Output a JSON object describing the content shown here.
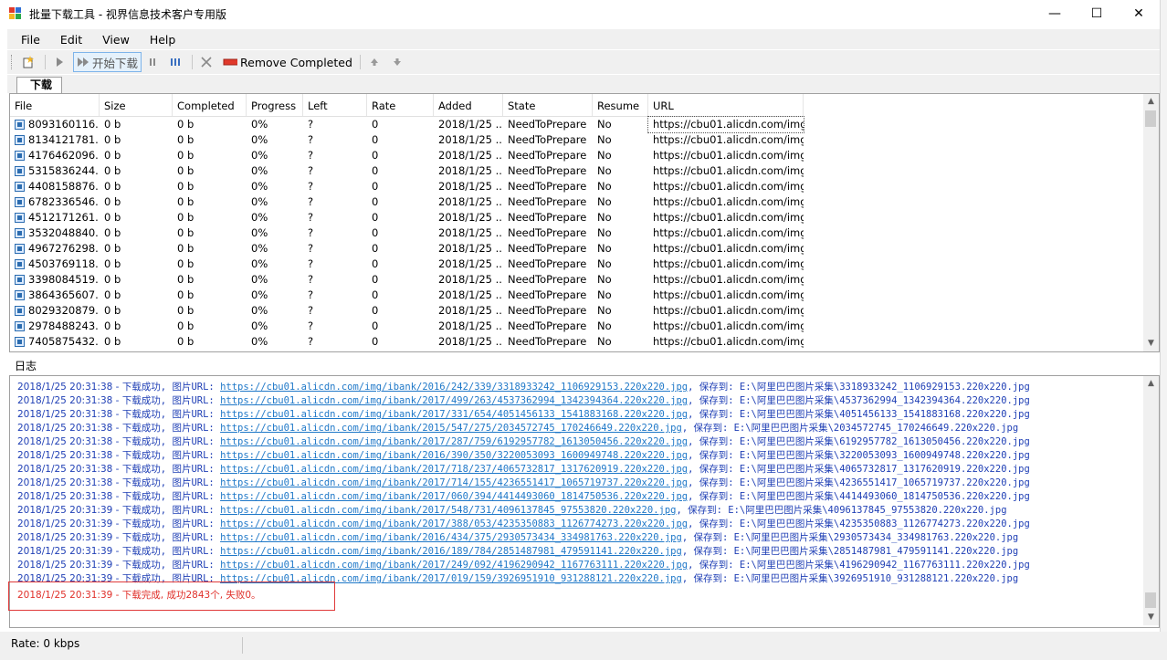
{
  "window": {
    "title": "批量下载工具 - 视界信息技术客户专用版",
    "minimize": "—",
    "maximize": "☐",
    "close": "✕"
  },
  "menu": [
    "File",
    "Edit",
    "View",
    "Help"
  ],
  "toolbar": {
    "start_label": "开始下载",
    "remove_label": "Remove Completed"
  },
  "tab": "下载",
  "table": {
    "columns": [
      "File",
      "Size",
      "Completed",
      "Progress",
      "Left",
      "Rate",
      "Added",
      "State",
      "Resume",
      "URL"
    ],
    "rows": [
      [
        "8093160116...",
        "0 b",
        "0 b",
        "0%",
        "?",
        "0",
        "2018/1/25 ...",
        "NeedToPrepare",
        "No",
        "https://cbu01.alicdn.com/img/i..."
      ],
      [
        "8134121781...",
        "0 b",
        "0 b",
        "0%",
        "?",
        "0",
        "2018/1/25 ...",
        "NeedToPrepare",
        "No",
        "https://cbu01.alicdn.com/img/i..."
      ],
      [
        "4176462096...",
        "0 b",
        "0 b",
        "0%",
        "?",
        "0",
        "2018/1/25 ...",
        "NeedToPrepare",
        "No",
        "https://cbu01.alicdn.com/img/i..."
      ],
      [
        "5315836244...",
        "0 b",
        "0 b",
        "0%",
        "?",
        "0",
        "2018/1/25 ...",
        "NeedToPrepare",
        "No",
        "https://cbu01.alicdn.com/img/i..."
      ],
      [
        "4408158876...",
        "0 b",
        "0 b",
        "0%",
        "?",
        "0",
        "2018/1/25 ...",
        "NeedToPrepare",
        "No",
        "https://cbu01.alicdn.com/img/i..."
      ],
      [
        "6782336546...",
        "0 b",
        "0 b",
        "0%",
        "?",
        "0",
        "2018/1/25 ...",
        "NeedToPrepare",
        "No",
        "https://cbu01.alicdn.com/img/i..."
      ],
      [
        "4512171261...",
        "0 b",
        "0 b",
        "0%",
        "?",
        "0",
        "2018/1/25 ...",
        "NeedToPrepare",
        "No",
        "https://cbu01.alicdn.com/img/i..."
      ],
      [
        "3532048840...",
        "0 b",
        "0 b",
        "0%",
        "?",
        "0",
        "2018/1/25 ...",
        "NeedToPrepare",
        "No",
        "https://cbu01.alicdn.com/img/i..."
      ],
      [
        "4967276298...",
        "0 b",
        "0 b",
        "0%",
        "?",
        "0",
        "2018/1/25 ...",
        "NeedToPrepare",
        "No",
        "https://cbu01.alicdn.com/img/i..."
      ],
      [
        "4503769118...",
        "0 b",
        "0 b",
        "0%",
        "?",
        "0",
        "2018/1/25 ...",
        "NeedToPrepare",
        "No",
        "https://cbu01.alicdn.com/img/i..."
      ],
      [
        "3398084519...",
        "0 b",
        "0 b",
        "0%",
        "?",
        "0",
        "2018/1/25 ...",
        "NeedToPrepare",
        "No",
        "https://cbu01.alicdn.com/img/i..."
      ],
      [
        "3864365607...",
        "0 b",
        "0 b",
        "0%",
        "?",
        "0",
        "2018/1/25 ...",
        "NeedToPrepare",
        "No",
        "https://cbu01.alicdn.com/img/i..."
      ],
      [
        "8029320879...",
        "0 b",
        "0 b",
        "0%",
        "?",
        "0",
        "2018/1/25 ...",
        "NeedToPrepare",
        "No",
        "https://cbu01.alicdn.com/img/i..."
      ],
      [
        "2978488243...",
        "0 b",
        "0 b",
        "0%",
        "?",
        "0",
        "2018/1/25 ...",
        "NeedToPrepare",
        "No",
        "https://cbu01.alicdn.com/img/i..."
      ],
      [
        "7405875432...",
        "0 b",
        "0 b",
        "0%",
        "?",
        "0",
        "2018/1/25 ...",
        "NeedToPrepare",
        "No",
        "https://cbu01.alicdn.com/img/i..."
      ]
    ]
  },
  "log": {
    "label": "日志",
    "lines": [
      {
        "ts": "2018/1/25 20:31:38 - ",
        "pre": "下载成功, 图片URL: ",
        "url": "https://cbu01.alicdn.com/img/ibank/2016/242/339/3318933242_1106929153.220x220.jpg",
        "post": ", 保存到: E:\\阿里巴巴图片采集\\3318933242_1106929153.220x220.jpg"
      },
      {
        "ts": "2018/1/25 20:31:38 - ",
        "pre": "下载成功, 图片URL: ",
        "url": "https://cbu01.alicdn.com/img/ibank/2017/499/263/4537362994_1342394364.220x220.jpg",
        "post": ", 保存到: E:\\阿里巴巴图片采集\\4537362994_1342394364.220x220.jpg"
      },
      {
        "ts": "2018/1/25 20:31:38 - ",
        "pre": "下载成功, 图片URL: ",
        "url": "https://cbu01.alicdn.com/img/ibank/2017/331/654/4051456133_1541883168.220x220.jpg",
        "post": ", 保存到: E:\\阿里巴巴图片采集\\4051456133_1541883168.220x220.jpg"
      },
      {
        "ts": "2018/1/25 20:31:38 - ",
        "pre": "下载成功, 图片URL: ",
        "url": "https://cbu01.alicdn.com/img/ibank/2015/547/275/2034572745_170246649.220x220.jpg",
        "post": ", 保存到: E:\\阿里巴巴图片采集\\2034572745_170246649.220x220.jpg"
      },
      {
        "ts": "2018/1/25 20:31:38 - ",
        "pre": "下载成功, 图片URL: ",
        "url": "https://cbu01.alicdn.com/img/ibank/2017/287/759/6192957782_1613050456.220x220.jpg",
        "post": ", 保存到: E:\\阿里巴巴图片采集\\6192957782_1613050456.220x220.jpg"
      },
      {
        "ts": "2018/1/25 20:31:38 - ",
        "pre": "下载成功, 图片URL: ",
        "url": "https://cbu01.alicdn.com/img/ibank/2016/390/350/3220053093_1600949748.220x220.jpg",
        "post": ", 保存到: E:\\阿里巴巴图片采集\\3220053093_1600949748.220x220.jpg"
      },
      {
        "ts": "2018/1/25 20:31:38 - ",
        "pre": "下载成功, 图片URL: ",
        "url": "https://cbu01.alicdn.com/img/ibank/2017/718/237/4065732817_1317620919.220x220.jpg",
        "post": ", 保存到: E:\\阿里巴巴图片采集\\4065732817_1317620919.220x220.jpg"
      },
      {
        "ts": "2018/1/25 20:31:38 - ",
        "pre": "下载成功, 图片URL: ",
        "url": "https://cbu01.alicdn.com/img/ibank/2017/714/155/4236551417_1065719737.220x220.jpg",
        "post": ", 保存到: E:\\阿里巴巴图片采集\\4236551417_1065719737.220x220.jpg"
      },
      {
        "ts": "2018/1/25 20:31:38 - ",
        "pre": "下载成功, 图片URL: ",
        "url": "https://cbu01.alicdn.com/img/ibank/2017/060/394/4414493060_1814750536.220x220.jpg",
        "post": ", 保存到: E:\\阿里巴巴图片采集\\4414493060_1814750536.220x220.jpg"
      },
      {
        "ts": "2018/1/25 20:31:39 - ",
        "pre": "下载成功, 图片URL: ",
        "url": "https://cbu01.alicdn.com/img/ibank/2017/548/731/4096137845_97553820.220x220.jpg",
        "post": ", 保存到: E:\\阿里巴巴图片采集\\4096137845_97553820.220x220.jpg"
      },
      {
        "ts": "2018/1/25 20:31:39 - ",
        "pre": "下载成功, 图片URL: ",
        "url": "https://cbu01.alicdn.com/img/ibank/2017/388/053/4235350883_1126774273.220x220.jpg",
        "post": ", 保存到: E:\\阿里巴巴图片采集\\4235350883_1126774273.220x220.jpg"
      },
      {
        "ts": "2018/1/25 20:31:39 - ",
        "pre": "下载成功, 图片URL: ",
        "url": "https://cbu01.alicdn.com/img/ibank/2016/434/375/2930573434_334981763.220x220.jpg",
        "post": ", 保存到: E:\\阿里巴巴图片采集\\2930573434_334981763.220x220.jpg"
      },
      {
        "ts": "2018/1/25 20:31:39 - ",
        "pre": "下载成功, 图片URL: ",
        "url": "https://cbu01.alicdn.com/img/ibank/2016/189/784/2851487981_479591141.220x220.jpg",
        "post": ", 保存到: E:\\阿里巴巴图片采集\\2851487981_479591141.220x220.jpg"
      },
      {
        "ts": "2018/1/25 20:31:39 - ",
        "pre": "下载成功, 图片URL: ",
        "url": "https://cbu01.alicdn.com/img/ibank/2017/249/092/4196290942_1167763111.220x220.jpg",
        "post": ", 保存到: E:\\阿里巴巴图片采集\\4196290942_1167763111.220x220.jpg"
      },
      {
        "ts": "2018/1/25 20:31:39 - ",
        "pre": "下载成功, 图片URL: ",
        "url": "https://cbu01.alicdn.com/img/ibank/2017/019/159/3926951910_931288121.220x220.jpg",
        "post": ", 保存到: E:\\阿里巴巴图片采集\\3926951910_931288121.220x220.jpg"
      }
    ],
    "done": "2018/1/25 20:31:39 - 下载完成, 成功2843个, 失败0。"
  },
  "status": {
    "rate": "Rate:  0 kbps"
  },
  "colors": {
    "log_text": "#1f3fb5",
    "log_link": "#1f78c8",
    "log_done": "#e0302a",
    "highlight": "#e03a3a"
  }
}
